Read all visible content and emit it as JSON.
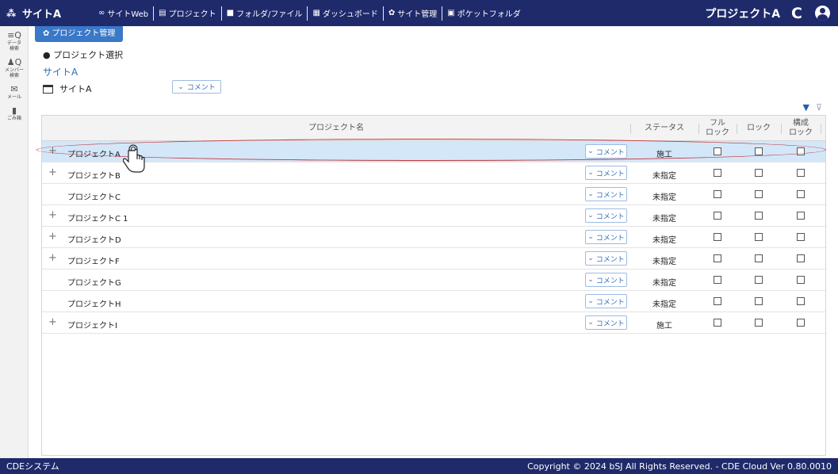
{
  "topbar": {
    "site_label": "サイトA",
    "nav": [
      {
        "icon": "link-icon",
        "glyph": "∞",
        "label": "サイトWeb"
      },
      {
        "icon": "project-icon",
        "glyph": "▤",
        "label": "プロジェクト"
      },
      {
        "icon": "folder-icon",
        "glyph": "■",
        "label": "フォルダ/ファイル"
      },
      {
        "icon": "dashboard-icon",
        "glyph": "▦",
        "label": "ダッシュボード"
      },
      {
        "icon": "gear-icon",
        "glyph": "✿",
        "label": "サイト管理"
      },
      {
        "icon": "pocket-folder-icon",
        "glyph": "▣",
        "label": "ポケットフォルダ"
      }
    ],
    "project_label": "プロジェクトA",
    "refresh_glyph": "C"
  },
  "sidebar": [
    {
      "icon": "data-search-icon",
      "glyph": "≡Q",
      "label1": "データ",
      "label2": "検索"
    },
    {
      "icon": "member-search-icon",
      "glyph": "♟Q",
      "label1": "メンバー",
      "label2": "検索"
    },
    {
      "icon": "mail-icon",
      "glyph": "✉",
      "label1": "メール",
      "label2": ""
    },
    {
      "icon": "trash-icon",
      "glyph": "▮",
      "label1": "ごみ箱",
      "label2": ""
    }
  ],
  "tab": {
    "label": "プロジェクト管理"
  },
  "selection_heading": "● プロジェクト選択",
  "site": {
    "heading": "サイトA",
    "name": "サイトA",
    "comment_label": "コメント"
  },
  "table": {
    "headers": {
      "name": "プロジェクト名",
      "status": "ステータス",
      "full_lock_1": "フル",
      "full_lock_2": "ロック",
      "lock": "ロック",
      "config_lock_1": "構成",
      "config_lock_2": "ロック"
    },
    "comment_label": "コメント",
    "rows": [
      {
        "name": "プロジェクトA",
        "expandable": true,
        "status": "施工",
        "selected": true
      },
      {
        "name": "プロジェクトB",
        "expandable": true,
        "status": "未指定",
        "selected": false
      },
      {
        "name": "プロジェクトC",
        "expandable": false,
        "status": "未指定",
        "selected": false
      },
      {
        "name": "プロジェクトC 1",
        "expandable": true,
        "status": "未指定",
        "selected": false
      },
      {
        "name": "プロジェクトD",
        "expandable": true,
        "status": "未指定",
        "selected": false
      },
      {
        "name": "プロジェクトF",
        "expandable": true,
        "status": "未指定",
        "selected": false
      },
      {
        "name": "プロジェクトG",
        "expandable": false,
        "status": "未指定",
        "selected": false
      },
      {
        "name": "プロジェクトH",
        "expandable": false,
        "status": "未指定",
        "selected": false
      },
      {
        "name": "プロジェクトI",
        "expandable": true,
        "status": "施工",
        "selected": false
      }
    ]
  },
  "footer": {
    "left": "CDEシステム",
    "right": "Copyright © 2024 bSJ All Rights Reserved. - CDE Cloud Ver 0.80.0010"
  },
  "colors": {
    "nav_bg": "#1f2a6b",
    "accent": "#3a78c8",
    "selected_row": "#d3e7f9",
    "highlight": "#c0393b"
  }
}
